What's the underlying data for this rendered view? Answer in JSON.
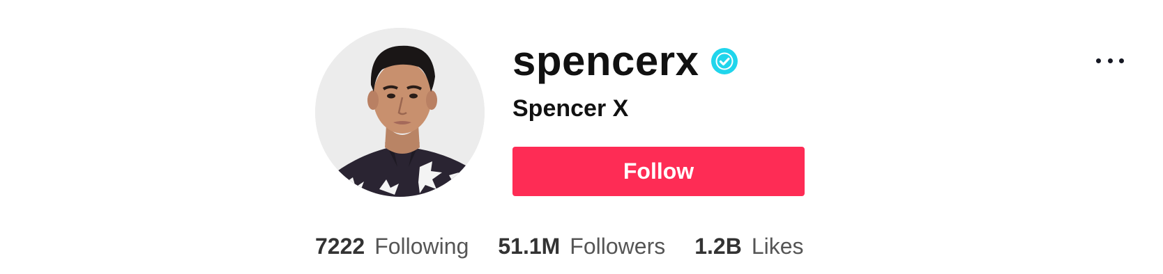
{
  "profile": {
    "username": "spencerx",
    "display_name": "Spencer X",
    "verified": true,
    "verified_icon": "check-badge-icon",
    "avatar_icon": "profile-photo",
    "follow_label": "Follow",
    "more_icon": "more-horizontal-icon"
  },
  "stats": [
    {
      "value": "7222",
      "label": "Following"
    },
    {
      "value": "51.1M",
      "label": "Followers"
    },
    {
      "value": "1.2B",
      "label": "Likes"
    }
  ],
  "colors": {
    "accent": "#fe2c55",
    "verified": "#20d5ec",
    "text": "#161823"
  }
}
